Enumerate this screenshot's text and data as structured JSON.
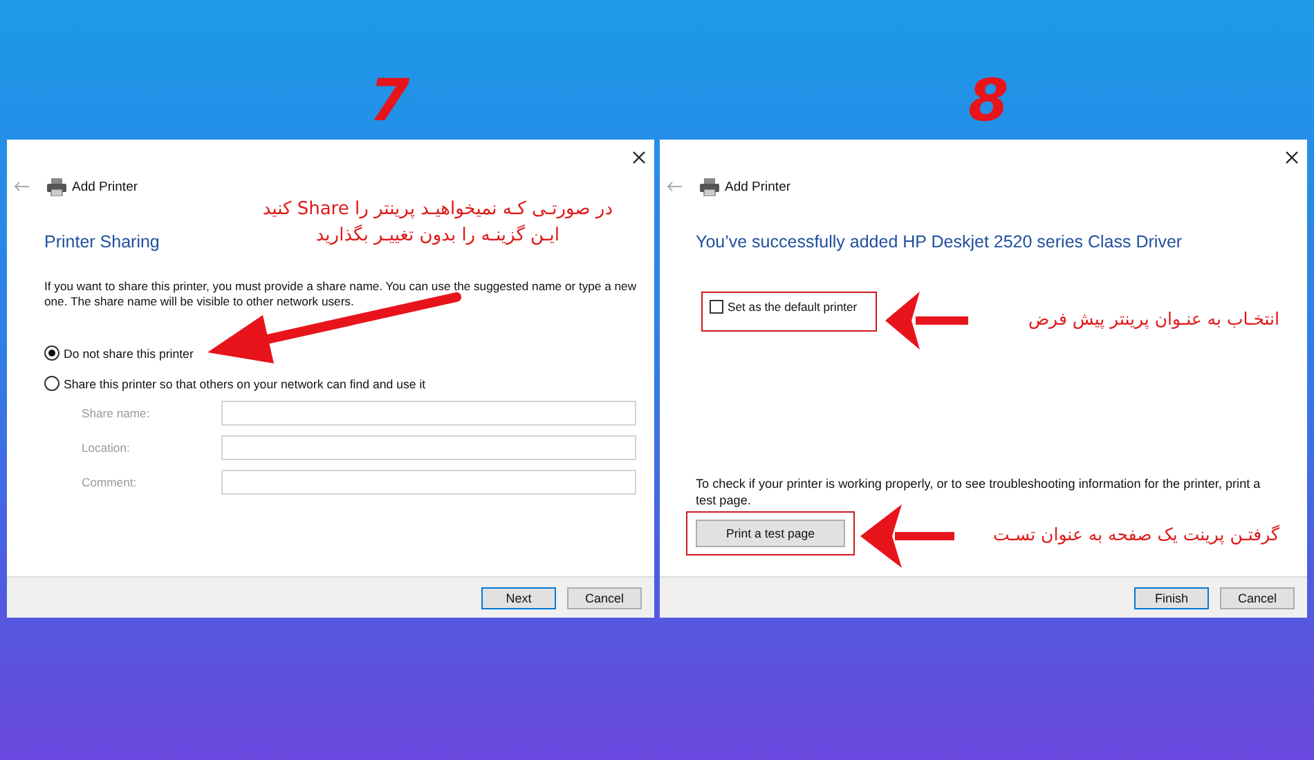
{
  "panels": [
    {
      "step": "7",
      "kind": "sharing",
      "title": "Add Printer",
      "heading": "Printer Sharing",
      "intro": "If you want to share this printer, you must provide a share name. You can use the suggested name or type a new one. The share name will be visible to other network users.",
      "options": [
        {
          "label": "Do not share this printer",
          "selected": true
        },
        {
          "label": "Share this printer so that others on your network can find and use it",
          "selected": false
        }
      ],
      "fields": [
        {
          "label": "Share name:",
          "disabled": true
        },
        {
          "label": "Location:",
          "disabled": true
        },
        {
          "label": "Comment:",
          "disabled": true
        }
      ],
      "annotations": [
        {
          "text": "در صورتـی کـه نمیخواهیـد پرینتر را Share کنید"
        },
        {
          "text": "ایـن گزینـه را بدون تغییـر بگذارید"
        }
      ],
      "buttons": [
        {
          "label": "Next",
          "default": true
        },
        {
          "label": "Cancel",
          "default": false
        }
      ]
    },
    {
      "step": "8",
      "kind": "finished",
      "title": "Add Printer",
      "heading": "You’ve successfully added HP Deskjet 2520 series Class Driver",
      "checkbox": {
        "label": "Set as the default printer",
        "checked": false
      },
      "help": "To check if your printer is working properly, or to see troubleshooting information for the printer, print a test page.",
      "test_button": "Print a test page",
      "annotations": [
        {
          "text": "انتخـاب به عنـوان پرینتر پیش فرض"
        },
        {
          "text": "گرفتـن پرینت یک صفحه به عنوان تسـت"
        }
      ],
      "buttons": [
        {
          "label": "Finish",
          "default": true
        },
        {
          "label": "Cancel",
          "default": false
        }
      ]
    }
  ]
}
